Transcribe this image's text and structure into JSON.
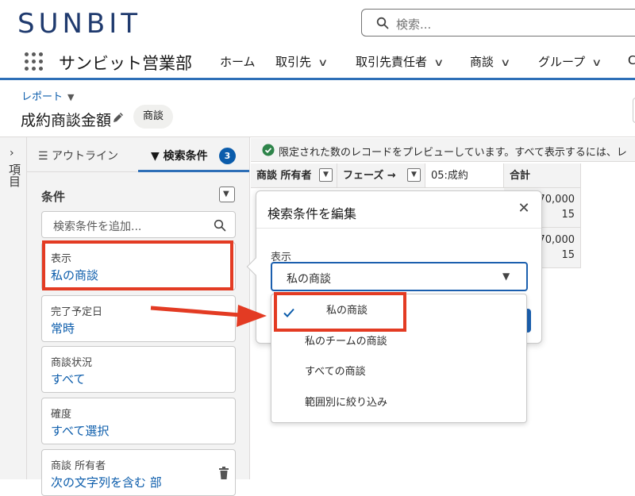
{
  "header": {
    "logo": "SUNBIT",
    "search_placeholder": "検索...",
    "app_name": "サンビット営業部",
    "nav": [
      {
        "label": "ホーム",
        "has_menu": false
      },
      {
        "label": "取引先",
        "has_menu": true
      },
      {
        "label": "取引先責任者",
        "has_menu": true
      },
      {
        "label": "商談",
        "has_menu": true
      },
      {
        "label": "グループ",
        "has_menu": true
      },
      {
        "label": "C",
        "has_menu": false
      }
    ]
  },
  "report": {
    "crumb": "レポート",
    "title": "成約商談金額",
    "object_badge": "商談"
  },
  "rail": {
    "label": "項目"
  },
  "panel": {
    "tab_outline": "アウトライン",
    "tab_filters": "検索条件",
    "filter_count": "3",
    "conditions_label": "条件",
    "add_filter_placeholder": "検索条件を追加...",
    "filters": [
      {
        "label": "表示",
        "value": "私の商談"
      },
      {
        "label": "完了予定日",
        "value": "常時"
      },
      {
        "label": "商談状況",
        "value": "すべて"
      },
      {
        "label": "確度",
        "value": "すべて選択"
      },
      {
        "label": "商談 所有者",
        "value": "次の文字列を含む 部"
      }
    ]
  },
  "preview": {
    "notice": "限定された数のレコードをプレビューしています。すべて表示するには、レ",
    "columns": [
      "商談 所有者",
      "フェーズ →",
      "05:成約",
      "合計"
    ],
    "rows": [
      {
        "amount": "70,000",
        "count": "15"
      },
      {
        "amount": "70,000",
        "count": "15"
      }
    ]
  },
  "popover": {
    "title": "検索条件を編集",
    "show_label": "表示",
    "selected": "私の商談",
    "options": [
      "私の商談",
      "私のチームの商談",
      "すべての商談",
      "範囲別に絞り込み"
    ]
  },
  "colors": {
    "accent": "#0b5cab",
    "highlight": "#e33b23",
    "header_line": "#2e6fb7"
  }
}
